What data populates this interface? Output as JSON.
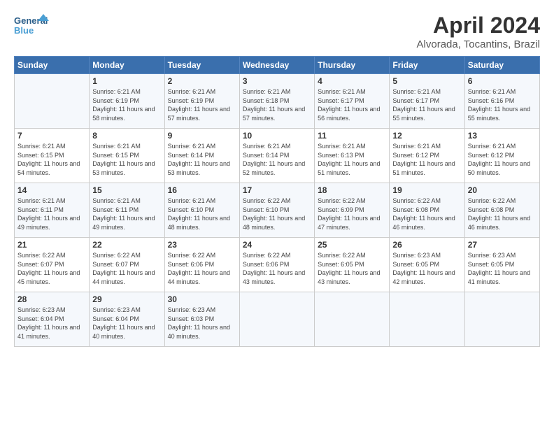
{
  "logo": {
    "line1": "General",
    "line2": "Blue"
  },
  "title": "April 2024",
  "location": "Alvorada, Tocantins, Brazil",
  "days_of_week": [
    "Sunday",
    "Monday",
    "Tuesday",
    "Wednesday",
    "Thursday",
    "Friday",
    "Saturday"
  ],
  "weeks": [
    [
      {
        "day": "",
        "sunrise": "",
        "sunset": "",
        "daylight": ""
      },
      {
        "day": "1",
        "sunrise": "Sunrise: 6:21 AM",
        "sunset": "Sunset: 6:19 PM",
        "daylight": "Daylight: 11 hours and 58 minutes."
      },
      {
        "day": "2",
        "sunrise": "Sunrise: 6:21 AM",
        "sunset": "Sunset: 6:19 PM",
        "daylight": "Daylight: 11 hours and 57 minutes."
      },
      {
        "day": "3",
        "sunrise": "Sunrise: 6:21 AM",
        "sunset": "Sunset: 6:18 PM",
        "daylight": "Daylight: 11 hours and 57 minutes."
      },
      {
        "day": "4",
        "sunrise": "Sunrise: 6:21 AM",
        "sunset": "Sunset: 6:17 PM",
        "daylight": "Daylight: 11 hours and 56 minutes."
      },
      {
        "day": "5",
        "sunrise": "Sunrise: 6:21 AM",
        "sunset": "Sunset: 6:17 PM",
        "daylight": "Daylight: 11 hours and 55 minutes."
      },
      {
        "day": "6",
        "sunrise": "Sunrise: 6:21 AM",
        "sunset": "Sunset: 6:16 PM",
        "daylight": "Daylight: 11 hours and 55 minutes."
      }
    ],
    [
      {
        "day": "7",
        "sunrise": "Sunrise: 6:21 AM",
        "sunset": "Sunset: 6:15 PM",
        "daylight": "Daylight: 11 hours and 54 minutes."
      },
      {
        "day": "8",
        "sunrise": "Sunrise: 6:21 AM",
        "sunset": "Sunset: 6:15 PM",
        "daylight": "Daylight: 11 hours and 53 minutes."
      },
      {
        "day": "9",
        "sunrise": "Sunrise: 6:21 AM",
        "sunset": "Sunset: 6:14 PM",
        "daylight": "Daylight: 11 hours and 53 minutes."
      },
      {
        "day": "10",
        "sunrise": "Sunrise: 6:21 AM",
        "sunset": "Sunset: 6:14 PM",
        "daylight": "Daylight: 11 hours and 52 minutes."
      },
      {
        "day": "11",
        "sunrise": "Sunrise: 6:21 AM",
        "sunset": "Sunset: 6:13 PM",
        "daylight": "Daylight: 11 hours and 51 minutes."
      },
      {
        "day": "12",
        "sunrise": "Sunrise: 6:21 AM",
        "sunset": "Sunset: 6:12 PM",
        "daylight": "Daylight: 11 hours and 51 minutes."
      },
      {
        "day": "13",
        "sunrise": "Sunrise: 6:21 AM",
        "sunset": "Sunset: 6:12 PM",
        "daylight": "Daylight: 11 hours and 50 minutes."
      }
    ],
    [
      {
        "day": "14",
        "sunrise": "Sunrise: 6:21 AM",
        "sunset": "Sunset: 6:11 PM",
        "daylight": "Daylight: 11 hours and 49 minutes."
      },
      {
        "day": "15",
        "sunrise": "Sunrise: 6:21 AM",
        "sunset": "Sunset: 6:11 PM",
        "daylight": "Daylight: 11 hours and 49 minutes."
      },
      {
        "day": "16",
        "sunrise": "Sunrise: 6:21 AM",
        "sunset": "Sunset: 6:10 PM",
        "daylight": "Daylight: 11 hours and 48 minutes."
      },
      {
        "day": "17",
        "sunrise": "Sunrise: 6:22 AM",
        "sunset": "Sunset: 6:10 PM",
        "daylight": "Daylight: 11 hours and 48 minutes."
      },
      {
        "day": "18",
        "sunrise": "Sunrise: 6:22 AM",
        "sunset": "Sunset: 6:09 PM",
        "daylight": "Daylight: 11 hours and 47 minutes."
      },
      {
        "day": "19",
        "sunrise": "Sunrise: 6:22 AM",
        "sunset": "Sunset: 6:08 PM",
        "daylight": "Daylight: 11 hours and 46 minutes."
      },
      {
        "day": "20",
        "sunrise": "Sunrise: 6:22 AM",
        "sunset": "Sunset: 6:08 PM",
        "daylight": "Daylight: 11 hours and 46 minutes."
      }
    ],
    [
      {
        "day": "21",
        "sunrise": "Sunrise: 6:22 AM",
        "sunset": "Sunset: 6:07 PM",
        "daylight": "Daylight: 11 hours and 45 minutes."
      },
      {
        "day": "22",
        "sunrise": "Sunrise: 6:22 AM",
        "sunset": "Sunset: 6:07 PM",
        "daylight": "Daylight: 11 hours and 44 minutes."
      },
      {
        "day": "23",
        "sunrise": "Sunrise: 6:22 AM",
        "sunset": "Sunset: 6:06 PM",
        "daylight": "Daylight: 11 hours and 44 minutes."
      },
      {
        "day": "24",
        "sunrise": "Sunrise: 6:22 AM",
        "sunset": "Sunset: 6:06 PM",
        "daylight": "Daylight: 11 hours and 43 minutes."
      },
      {
        "day": "25",
        "sunrise": "Sunrise: 6:22 AM",
        "sunset": "Sunset: 6:05 PM",
        "daylight": "Daylight: 11 hours and 43 minutes."
      },
      {
        "day": "26",
        "sunrise": "Sunrise: 6:23 AM",
        "sunset": "Sunset: 6:05 PM",
        "daylight": "Daylight: 11 hours and 42 minutes."
      },
      {
        "day": "27",
        "sunrise": "Sunrise: 6:23 AM",
        "sunset": "Sunset: 6:05 PM",
        "daylight": "Daylight: 11 hours and 41 minutes."
      }
    ],
    [
      {
        "day": "28",
        "sunrise": "Sunrise: 6:23 AM",
        "sunset": "Sunset: 6:04 PM",
        "daylight": "Daylight: 11 hours and 41 minutes."
      },
      {
        "day": "29",
        "sunrise": "Sunrise: 6:23 AM",
        "sunset": "Sunset: 6:04 PM",
        "daylight": "Daylight: 11 hours and 40 minutes."
      },
      {
        "day": "30",
        "sunrise": "Sunrise: 6:23 AM",
        "sunset": "Sunset: 6:03 PM",
        "daylight": "Daylight: 11 hours and 40 minutes."
      },
      {
        "day": "",
        "sunrise": "",
        "sunset": "",
        "daylight": ""
      },
      {
        "day": "",
        "sunrise": "",
        "sunset": "",
        "daylight": ""
      },
      {
        "day": "",
        "sunrise": "",
        "sunset": "",
        "daylight": ""
      },
      {
        "day": "",
        "sunrise": "",
        "sunset": "",
        "daylight": ""
      }
    ]
  ]
}
